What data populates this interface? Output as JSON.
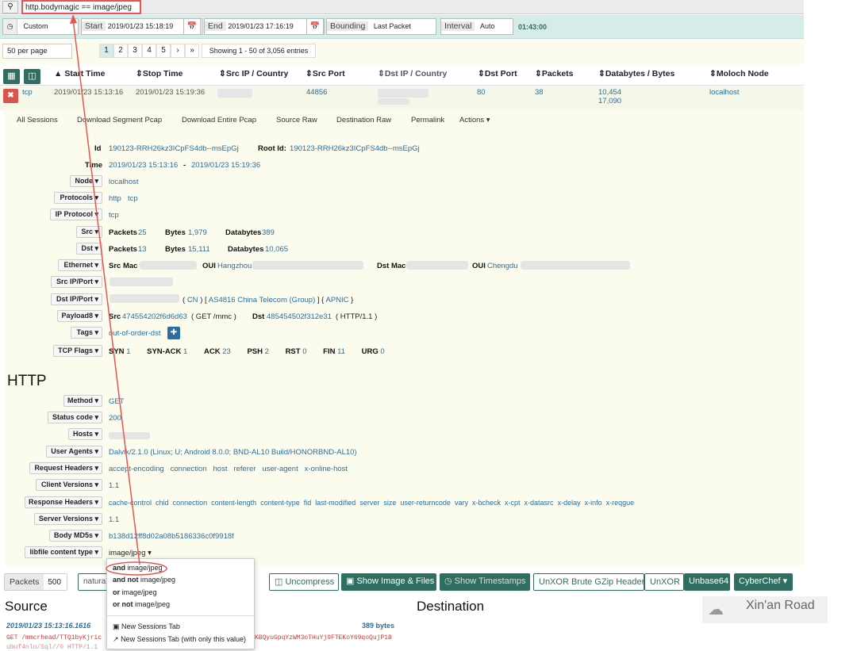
{
  "search": {
    "icon": "search-icon",
    "query": "http.bodymagic == image/jpeg"
  },
  "time": {
    "range_icon": "clock-icon",
    "range": "Custom",
    "start_label": "Start",
    "start": "2019/01/23 15:18:19",
    "end_label": "End",
    "end": "2019/01/23 17:16:19",
    "bounding_label": "Bounding",
    "bounding": "Last Packet",
    "interval_label": "Interval",
    "interval": "Auto",
    "duration": "01:43:00"
  },
  "paging": {
    "per_page": "50 per page",
    "pages": [
      "1",
      "2",
      "3",
      "4",
      "5",
      "›",
      "»"
    ],
    "showing": "Showing 1 - 50 of 3,056 entries"
  },
  "columns": {
    "start": "Start Time",
    "stop": "Stop Time",
    "src": "Src IP / Country",
    "src_port": "Src Port",
    "dst": "Dst IP / Country",
    "dst_port": "Dst Port",
    "packets": "Packets",
    "bytes": "Databytes / Bytes",
    "node": "Moloch Node"
  },
  "session": {
    "proto": "tcp",
    "start": "2019/01/23 15:13:16",
    "stop": "2019/01/23 15:19:36",
    "src_port": "44856",
    "dst_port": "80",
    "packets": "38",
    "databytes": "10,454",
    "bytes": "17,090",
    "node": "localhost"
  },
  "tabs": [
    "All Sessions",
    "Download Segment Pcap",
    "Download Entire Pcap",
    "Source Raw",
    "Destination Raw",
    "Permalink",
    "Actions"
  ],
  "detail": {
    "id_label": "Id",
    "id": "190123-RRH26kz3ICpFS4db--msEpGj",
    "root_label": "Root Id:",
    "root": "190123-RRH26kz3ICpFS4db--msEpGj",
    "time_label": "Time",
    "time_start": "2019/01/23 15:13:16",
    "time_sep": "-",
    "time_end": "2019/01/23 15:19:36",
    "node_label": "Node",
    "node": "localhost",
    "protocols_label": "Protocols",
    "protocols": [
      "http",
      "tcp"
    ],
    "ipproto_label": "IP Protocol",
    "ipproto": "tcp",
    "src_label": "Src",
    "src_packets_k": "Packets",
    "src_packets": "25",
    "src_bytes_k": "Bytes",
    "src_bytes": "1,979",
    "src_db_k": "Databytes",
    "src_db": "389",
    "dst_label": "Dst",
    "dst_packets_k": "Packets",
    "dst_packets": "13",
    "dst_bytes_k": "Bytes",
    "dst_bytes": "15,111",
    "dst_db_k": "Databytes",
    "dst_db": "10,065",
    "eth_label": "Ethernet",
    "src_mac_k": "Src Mac",
    "oui_k": "OUI",
    "src_oui": "Hangzhou",
    "dst_mac_k": "Dst Mac",
    "oui2_k": "OUI",
    "dst_oui": "Chengdu",
    "srcip_label": "Src IP/Port",
    "dstip_label": "Dst IP/Port",
    "dstip_info": [
      "(",
      "CN",
      ")",
      "[",
      "AS4816 China Telecom (Group)",
      "]",
      "{",
      "APNIC",
      "}"
    ],
    "payload_label": "Payload8",
    "payload_src_k": "Src",
    "payload_src": "474554202f6d6d63",
    "payload_src_note": "( GET /mmc )",
    "payload_dst_k": "Dst",
    "payload_dst": "485454502f312e31",
    "payload_dst_note": "( HTTP/1.1 )",
    "tags_label": "Tags",
    "tags": "out-of-order-dst",
    "tcp_label": "TCP Flags",
    "flags": [
      {
        "k": "SYN",
        "v": "1"
      },
      {
        "k": "SYN-ACK",
        "v": "1"
      },
      {
        "k": "ACK",
        "v": "23"
      },
      {
        "k": "PSH",
        "v": "2"
      },
      {
        "k": "RST",
        "v": "0"
      },
      {
        "k": "FIN",
        "v": "11"
      },
      {
        "k": "URG",
        "v": "0"
      }
    ]
  },
  "http": {
    "title": "HTTP",
    "method_label": "Method",
    "method": "GET",
    "status_label": "Status code",
    "status": "200",
    "hosts_label": "Hosts",
    "ua_label": "User Agents",
    "ua": "Dalvik/2.1.0 (Linux; U; Android 8.0.0; BND-AL10 Build/HONORBND-AL10)",
    "reqh_label": "Request Headers",
    "reqh": [
      "accept-encoding",
      "connection",
      "host",
      "referer",
      "user-agent",
      "x-online-host"
    ],
    "cver_label": "Client Versions",
    "cver": "1.1",
    "resh_label": "Response Headers",
    "resh": [
      "cache-control",
      "chid",
      "connection",
      "content-length",
      "content-type",
      "fid",
      "last-modified",
      "server",
      "size",
      "user-returncode",
      "vary",
      "x-bcheck",
      "x-cpt",
      "x-datasrc",
      "x-delay",
      "x-info",
      "x-reqgue"
    ],
    "sver_label": "Server Versions",
    "sver": "1.1",
    "md5_label": "Body MD5s",
    "md5": "b138d12ff8d02a08b5186336c0f9918f",
    "ctype_label": "libfile content type",
    "ctype": "image/jpeg"
  },
  "menu": {
    "items": [
      {
        "b": "and",
        "t": "image/jpeg"
      },
      {
        "b": "and not",
        "t": "image/jpeg"
      },
      {
        "b": "or",
        "t": "image/jpeg"
      },
      {
        "b": "or not",
        "t": "image/jpeg"
      }
    ],
    "new_tab": "New Sessions Tab",
    "new_tab_only": "New Sessions Tab (with only this value)"
  },
  "toolbar": {
    "packets_label": "Packets",
    "packets": "500",
    "natural": "natura",
    "uncompress": "Uncompress",
    "show_image": "Show Image & Files",
    "show_ts": "Show Timestamps",
    "unxor_gzip": "UnXOR Brute GZip Header",
    "unxor": "UnXOR",
    "unbase": "Unbase64",
    "cyberchef": "CyberChef"
  },
  "panes": {
    "source": "Source",
    "destination": "Destination",
    "ts": "2019/01/23 15:13:16.1616",
    "bytes": "389 bytes",
    "line1": "GET /mmcrhead/TTQ1byKjric",
    "line2": "KBQyuGpqYzWM3oTHuYj9FTEKoY69qoQujP1B",
    "line3": "ubuf4nln/Sql//0 HTTP/1.1"
  },
  "watermark": {
    "text": "Xin'an Road"
  },
  "colors": {
    "accent": "#2f6f62",
    "link": "#2c6d9d",
    "danger": "#d9534f",
    "highlight": "#e8554e"
  }
}
